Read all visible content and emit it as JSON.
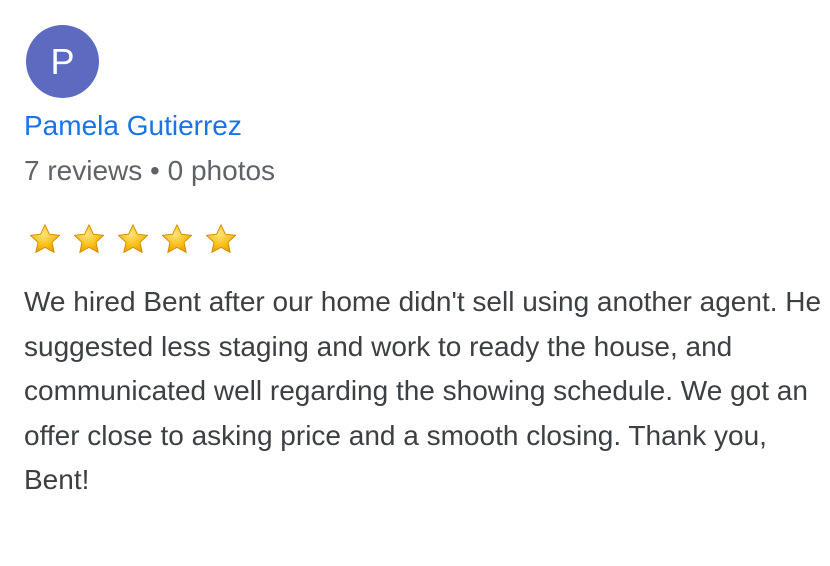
{
  "reviewer": {
    "avatar_initial": "P",
    "avatar_color": "#5c6bc0",
    "name": "Pamela Gutierrez",
    "meta": "7 reviews • 0 photos"
  },
  "rating": {
    "value": 5,
    "max": 5,
    "star_icon": "star-icon",
    "star_color": "#f5b400"
  },
  "review": {
    "text": "We hired Bent after our home didn't sell using another agent. He suggested less staging and work to ready the house, and communicated well regarding the showing schedule. We got an offer close to asking price and a smooth closing. Thank you, Bent!"
  },
  "colors": {
    "name_link": "#1a73e8",
    "meta_text": "#5f6368",
    "body_text": "#3c4043"
  }
}
